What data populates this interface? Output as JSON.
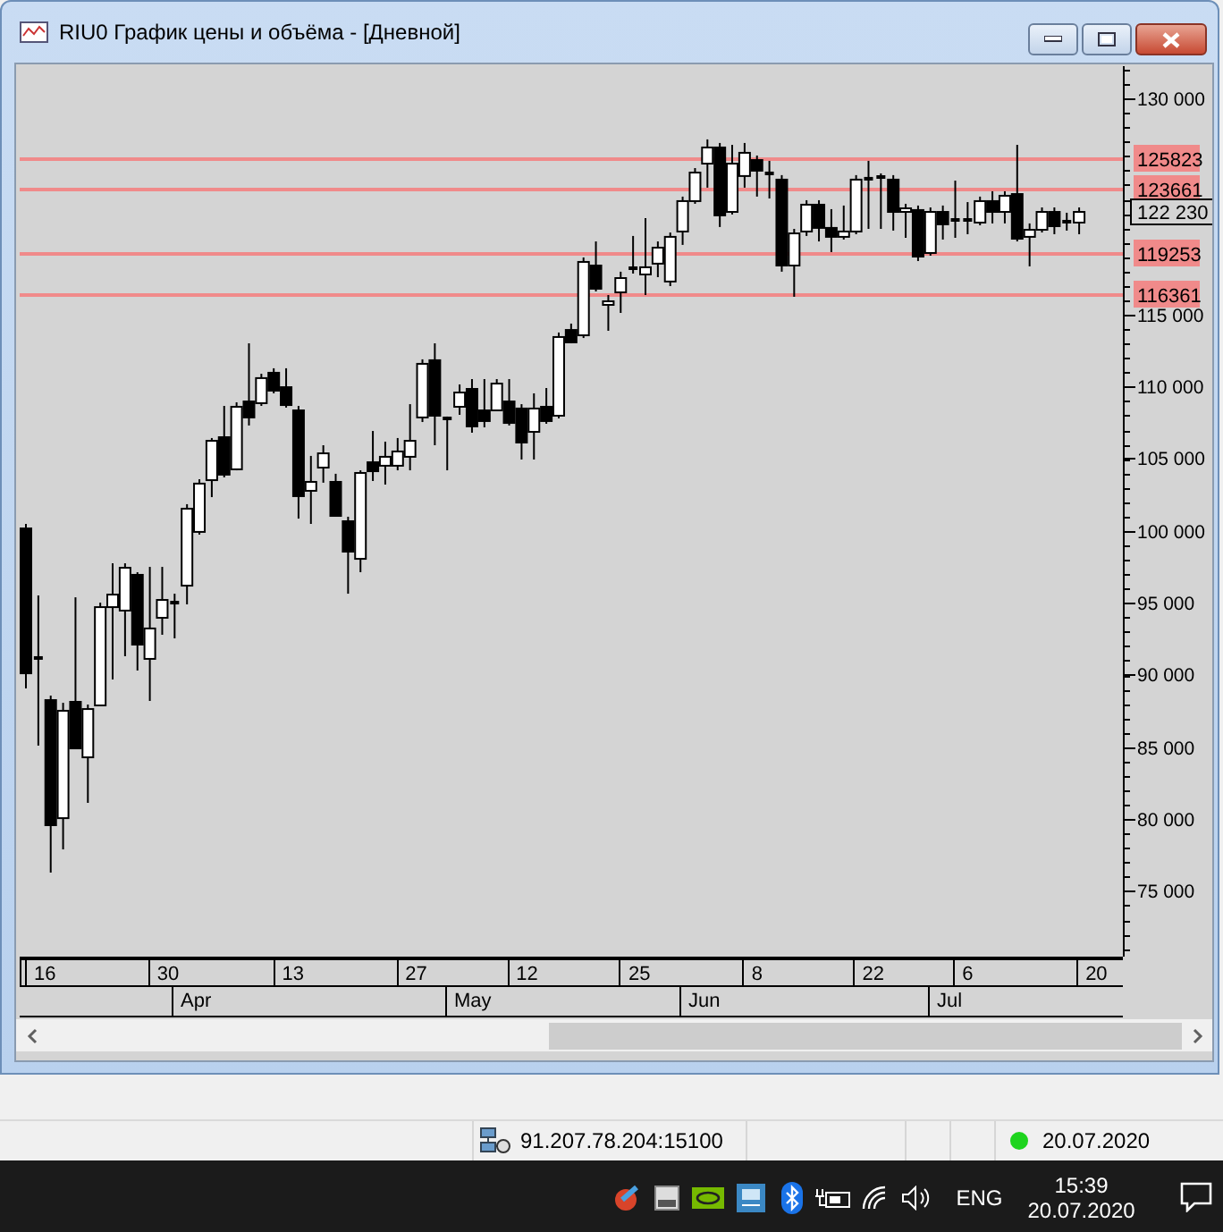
{
  "window": {
    "title": "RIU0 График цены и объёма - [Дневной]"
  },
  "chart": {
    "chart_data": {
      "type": "candlestick",
      "ohlc": [
        [
          100220,
          100470,
          89060,
          90170
        ],
        [
          91170,
          95510,
          85090,
          91170
        ],
        [
          88310,
          88560,
          76280,
          79630
        ],
        [
          80120,
          88060,
          77890,
          87570
        ],
        [
          88190,
          95380,
          84840,
          84960
        ],
        [
          84340,
          87940,
          81120,
          87690
        ],
        [
          87940,
          95010,
          87820,
          94760
        ],
        [
          94760,
          97740,
          89680,
          95630
        ],
        [
          94520,
          97740,
          91290,
          97490
        ],
        [
          97000,
          97120,
          90300,
          92160
        ],
        [
          91170,
          97490,
          88190,
          93280
        ],
        [
          94020,
          97490,
          92780,
          95260
        ],
        [
          95010,
          95630,
          92530,
          95010
        ],
        [
          96250,
          101840,
          94890,
          101590
        ],
        [
          99980,
          103570,
          99730,
          103330
        ],
        [
          103570,
          106430,
          102330,
          106300
        ],
        [
          106550,
          108660,
          103700,
          103950
        ],
        [
          104320,
          108910,
          104190,
          108660
        ],
        [
          109030,
          113000,
          107300,
          107920
        ],
        [
          108910,
          110890,
          108660,
          110650
        ],
        [
          111020,
          111270,
          109530,
          109780
        ],
        [
          110020,
          111270,
          108540,
          108780
        ],
        [
          108410,
          108660,
          100840,
          102460
        ],
        [
          102830,
          105190,
          100470,
          103450
        ],
        [
          104440,
          105930,
          103330,
          105430
        ],
        [
          103450,
          103950,
          100970,
          101090
        ],
        [
          100720,
          100970,
          95630,
          98610
        ],
        [
          98110,
          104190,
          97120,
          104070
        ],
        [
          104810,
          106920,
          103450,
          104190
        ],
        [
          104570,
          106180,
          103200,
          105190
        ],
        [
          104570,
          106430,
          104190,
          105560
        ],
        [
          105190,
          108780,
          104190,
          106300
        ],
        [
          107920,
          111890,
          107540,
          111640
        ],
        [
          111890,
          113000,
          105930,
          108040
        ],
        [
          107790,
          107920,
          104190,
          107790
        ],
        [
          108660,
          110150,
          108040,
          109650
        ],
        [
          109900,
          110520,
          106800,
          107300
        ],
        [
          108410,
          110520,
          107170,
          107670
        ],
        [
          108410,
          110520,
          108290,
          110270
        ],
        [
          109030,
          110520,
          107300,
          107540
        ],
        [
          108540,
          108780,
          104940,
          106180
        ],
        [
          106920,
          109530,
          104940,
          108540
        ],
        [
          108660,
          109900,
          107420,
          107670
        ],
        [
          108040,
          113750,
          107790,
          113500
        ],
        [
          113990,
          114370,
          113000,
          113130
        ],
        [
          113620,
          118960,
          113370,
          118710
        ],
        [
          118460,
          120070,
          116600,
          116850
        ],
        [
          115730,
          116350,
          113870,
          115980
        ],
        [
          116600,
          117970,
          115110,
          117590
        ],
        [
          118210,
          120450,
          117840,
          118210
        ],
        [
          117840,
          121690,
          116350,
          118340
        ],
        [
          118590,
          120070,
          117590,
          119700
        ],
        [
          117350,
          120690,
          116970,
          120450
        ],
        [
          120820,
          123180,
          119830,
          122930
        ],
        [
          122930,
          125160,
          122680,
          124910
        ],
        [
          125530,
          127150,
          123800,
          126650
        ],
        [
          126650,
          126900,
          121070,
          121940
        ],
        [
          122180,
          126770,
          121940,
          125530
        ],
        [
          124670,
          126900,
          123800,
          126280
        ],
        [
          125780,
          126030,
          123180,
          125040
        ],
        [
          124790,
          125660,
          123050,
          124790
        ],
        [
          124420,
          124670,
          117970,
          118460
        ],
        [
          118460,
          120940,
          116230,
          120690
        ],
        [
          120820,
          122930,
          120450,
          122680
        ],
        [
          122680,
          122930,
          120070,
          121070
        ],
        [
          121070,
          122310,
          119330,
          120450
        ],
        [
          120450,
          122560,
          120200,
          120820
        ],
        [
          120820,
          124670,
          120570,
          124420
        ],
        [
          124420,
          125660,
          120940,
          124420
        ],
        [
          124540,
          124790,
          120940,
          124540
        ],
        [
          124420,
          124670,
          120820,
          122180
        ],
        [
          122180,
          122680,
          120320,
          122430
        ],
        [
          122310,
          122560,
          118710,
          119080
        ],
        [
          119330,
          122430,
          119080,
          122180
        ],
        [
          122180,
          122560,
          120200,
          121320
        ],
        [
          121560,
          124290,
          120320,
          121560
        ],
        [
          121560,
          122800,
          120570,
          121560
        ],
        [
          121440,
          123180,
          121190,
          122930
        ],
        [
          122930,
          123550,
          121320,
          122180
        ],
        [
          122180,
          123550,
          121320,
          123300
        ],
        [
          123420,
          126770,
          120070,
          120320
        ],
        [
          120450,
          121320,
          118340,
          120940
        ],
        [
          120940,
          122430,
          120690,
          122180
        ],
        [
          122180,
          122430,
          120570,
          121190
        ],
        [
          121440,
          122060,
          120820,
          121440
        ],
        [
          121440,
          122430,
          120570,
          122180
        ]
      ],
      "ylim": [
        70450,
        132230
      ],
      "yticks": [
        {
          "value": 130000,
          "label": "130 000"
        },
        {
          "value": 115000,
          "label": "115 000"
        },
        {
          "value": 110000,
          "label": "110 000"
        },
        {
          "value": 105000,
          "label": "105 000"
        },
        {
          "value": 100000,
          "label": "100 000"
        },
        {
          "value": 95000,
          "label": "95 000"
        },
        {
          "value": 90000,
          "label": "90 000"
        },
        {
          "value": 85000,
          "label": "85 000"
        },
        {
          "value": 80000,
          "label": "80 000"
        },
        {
          "value": 75000,
          "label": "75 000"
        }
      ]
    },
    "levels": [
      {
        "label": "125823"
      },
      {
        "label": "123661"
      },
      {
        "label": "119253"
      },
      {
        "label": "116361"
      }
    ],
    "current_price": "122 230"
  },
  "date_axis": {
    "days": [
      "16",
      "30",
      "13",
      "27",
      "12",
      "25",
      "8",
      "22",
      "6",
      "20"
    ],
    "months": [
      "Apr",
      "May",
      "Jun",
      "Jul"
    ]
  },
  "status_bar": {
    "address": "91.207.78.204:15100",
    "connected": true,
    "date": "20.07.2020"
  },
  "taskbar": {
    "language": "ENG",
    "time": "15:39",
    "date": "20.07.2020"
  }
}
